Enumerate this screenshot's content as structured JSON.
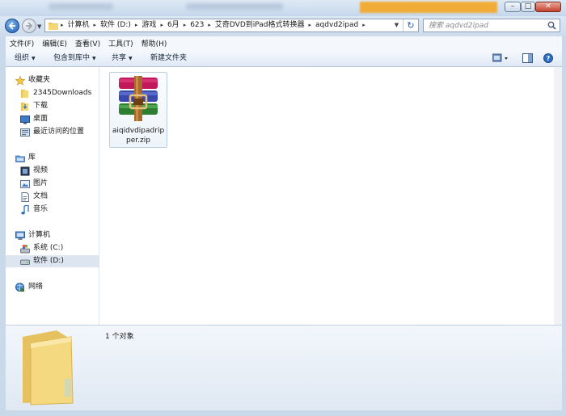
{
  "window": {
    "minimize_glyph": "–",
    "maximize_glyph": "□",
    "close_glyph": "✕"
  },
  "address": {
    "crumbs": [
      "计算机",
      "软件 (D:)",
      "游戏",
      "6月",
      "623",
      "艾奇DVD到iPad格式转换器",
      "aqdvd2ipad"
    ],
    "refresh_glyph": "↻"
  },
  "search": {
    "placeholder": "搜索 aqdvd2ipad"
  },
  "menubar": {
    "items": [
      "文件(F)",
      "编辑(E)",
      "查看(V)",
      "工具(T)",
      "帮助(H)"
    ]
  },
  "toolbar": {
    "organize": "组织",
    "include_in_library": "包含到库中",
    "share": "共享",
    "new_folder": "新建文件夹"
  },
  "nav": {
    "favorites": "收藏夹",
    "fav_items": [
      "2345Downloads",
      "下载",
      "桌面",
      "最近访问的位置"
    ],
    "libraries": "库",
    "lib_items": [
      "视频",
      "图片",
      "文档",
      "音乐"
    ],
    "computer": "计算机",
    "drives": [
      "系统 (C:)",
      "软件 (D:)"
    ],
    "network": "网络"
  },
  "files": [
    {
      "name": "aiqidvdipadripper.zip",
      "icon": "winrar-archive-icon"
    }
  ],
  "details": {
    "count_text": "1 个对象"
  },
  "colors": {
    "accent": "#1f5fb4",
    "selection": "#dde6f0"
  }
}
